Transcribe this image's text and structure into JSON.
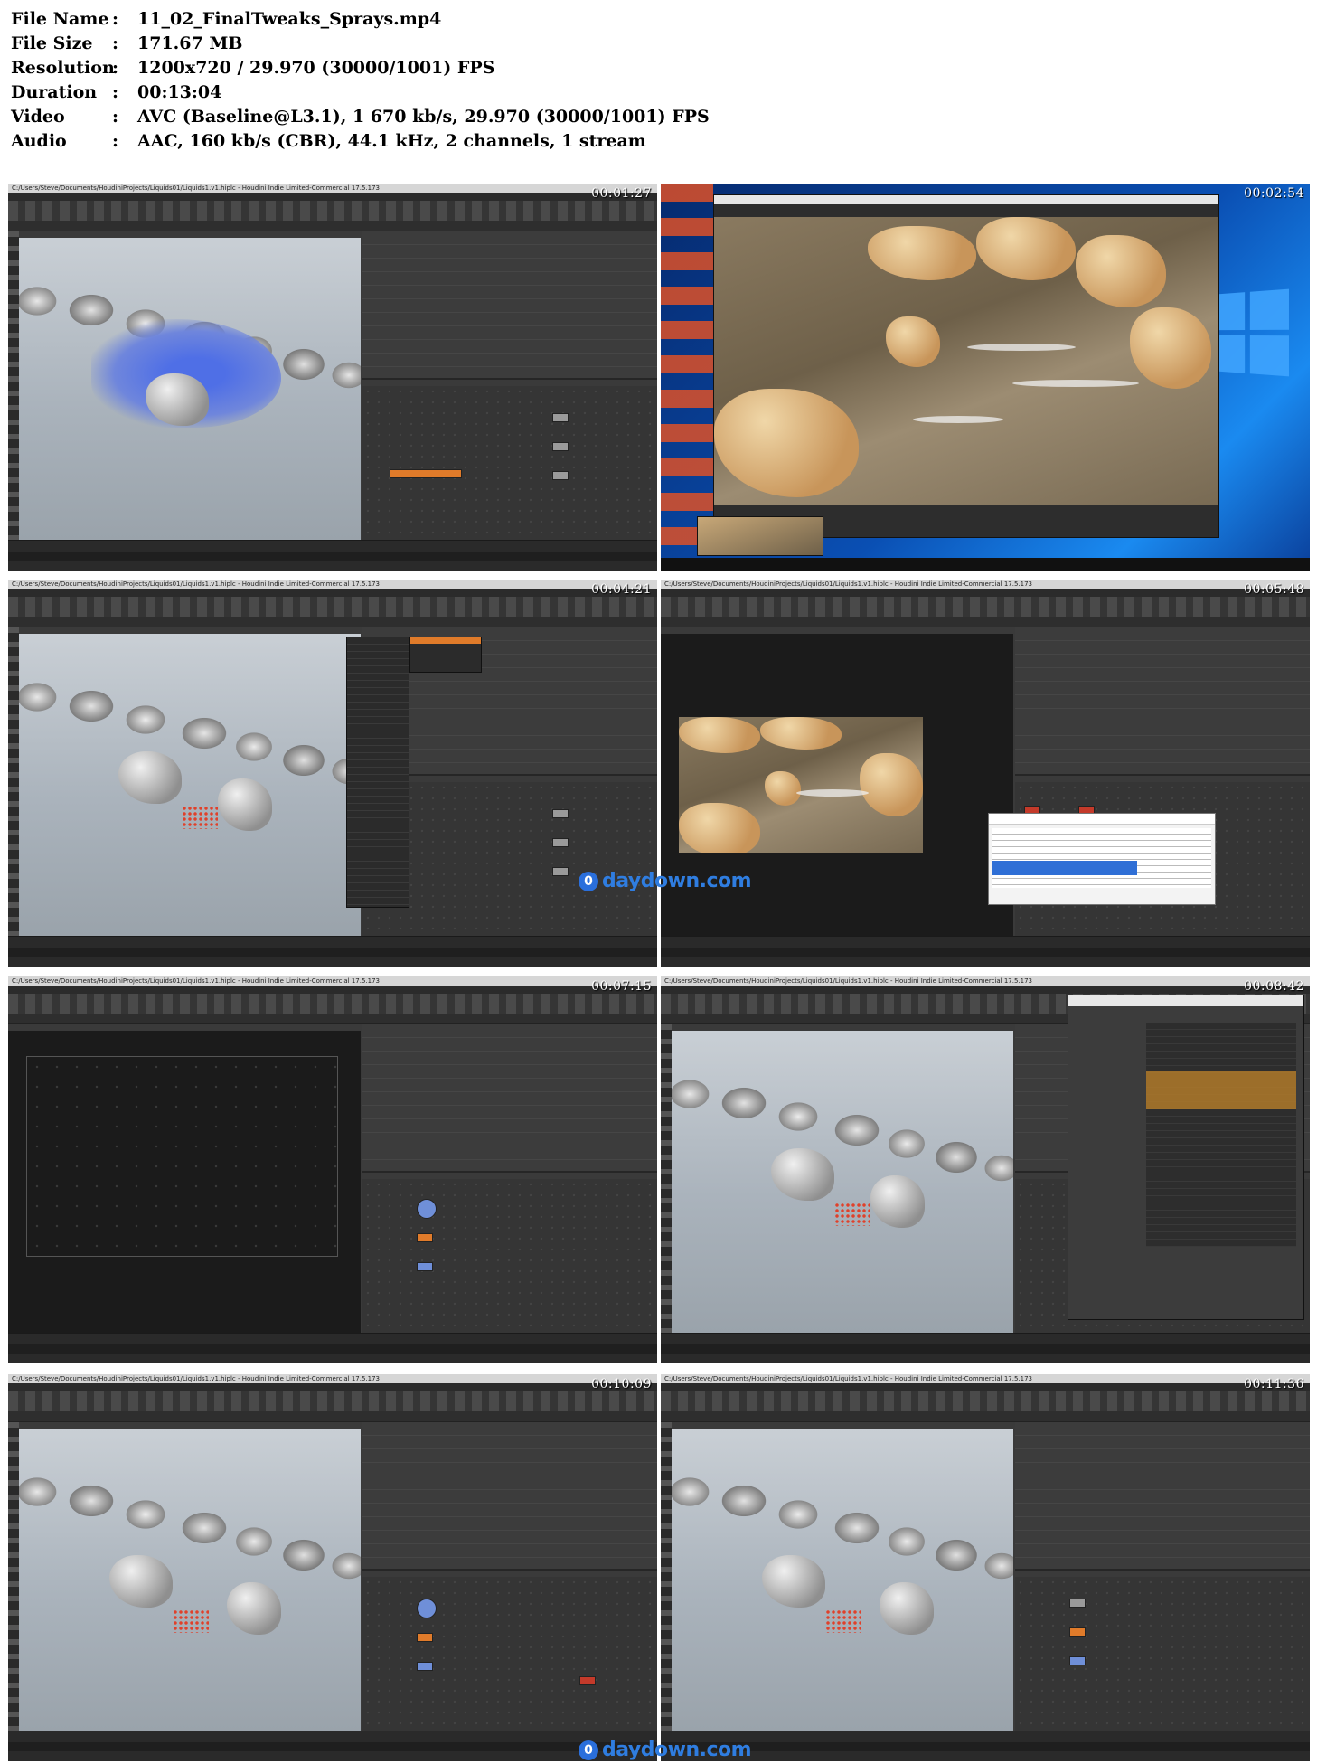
{
  "info": {
    "rows": [
      {
        "key": "File Name",
        "sep": ":",
        "value": "11_02_FinalTweaks_Sprays.mp4"
      },
      {
        "key": "File Size",
        "sep": ":",
        "value": "171.67 MB"
      },
      {
        "key": "Resolution",
        "sep": ":",
        "value": "1200x720 / 29.970 (30000/1001) FPS"
      },
      {
        "key": "Duration",
        "sep": ":",
        "value": "00:13:04"
      },
      {
        "key": "Video",
        "sep": ":",
        "value": "AVC (Baseline@L3.1), 1 670 kb/s, 29.970 (30000/1001) FPS"
      },
      {
        "key": "Audio",
        "sep": ":",
        "value": "AAC, 160 kb/s (CBR), 44.1 kHz, 2 channels, 1 stream"
      }
    ]
  },
  "window_title": "C:/Users/Steve/Documents/HoudiniProjects/Liquids01/Liquids1.v1.hiplc - Houdini Indie Limited-Commercial 17.5.173",
  "thumbnails": [
    {
      "timecode": "00:01:27"
    },
    {
      "timecode": "00:02:54"
    },
    {
      "timecode": "00:04:21"
    },
    {
      "timecode": "00:05:48"
    },
    {
      "timecode": "00:07:15"
    },
    {
      "timecode": "00:08:42"
    },
    {
      "timecode": "00:10:09"
    },
    {
      "timecode": "00:11:36"
    }
  ],
  "watermark": {
    "icon": "0",
    "text": "daydown.com"
  },
  "colors": {
    "accent_orange": "#e07b2a",
    "spray_red": "#e0402a",
    "watermark_blue": "#2f7de0"
  }
}
